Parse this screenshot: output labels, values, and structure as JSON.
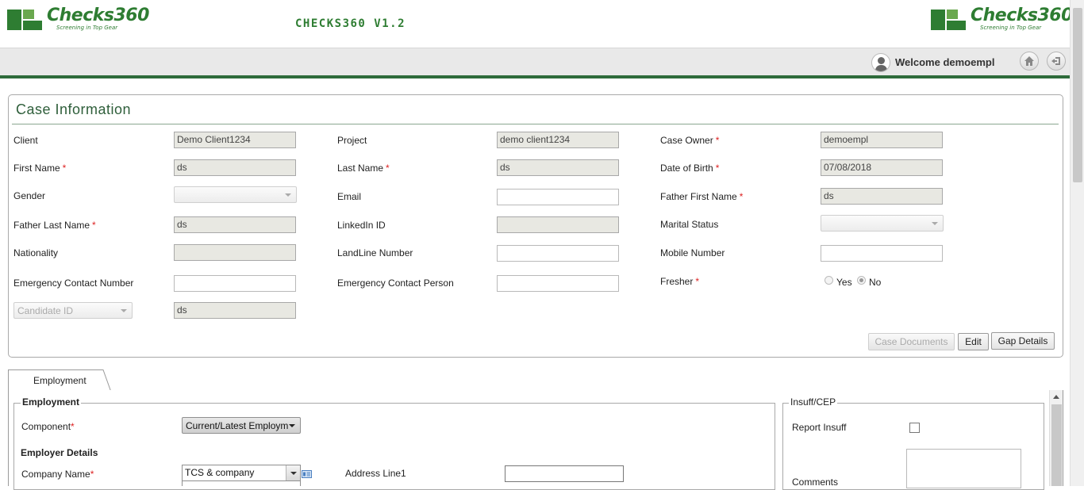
{
  "header": {
    "logo_text": "Checks360",
    "logo_tagline": "Screening in Top Gear",
    "app_title": "CHECKS360 V1.2",
    "welcome": "Welcome demoempl"
  },
  "case": {
    "title": "Case Information",
    "client": {
      "label": "Client",
      "value": "Demo Client1234"
    },
    "project": {
      "label": "Project",
      "value": "demo client1234"
    },
    "case_owner": {
      "label": "Case Owner",
      "value": "demoempl"
    },
    "first_name": {
      "label": "First Name",
      "value": "ds"
    },
    "last_name": {
      "label": "Last Name",
      "value": "ds"
    },
    "dob": {
      "label": "Date of Birth",
      "value": "07/08/2018"
    },
    "gender": {
      "label": "Gender",
      "value": ""
    },
    "email": {
      "label": "Email",
      "value": ""
    },
    "father_first_name": {
      "label": "Father First Name",
      "value": "ds"
    },
    "father_last_name": {
      "label": "Father Last Name",
      "value": "ds"
    },
    "linkedin": {
      "label": "LinkedIn ID",
      "value": ""
    },
    "marital_status": {
      "label": "Marital Status",
      "value": ""
    },
    "nationality": {
      "label": "Nationality",
      "value": ""
    },
    "landline": {
      "label": "LandLine Number",
      "value": ""
    },
    "mobile": {
      "label": "Mobile Number",
      "value": ""
    },
    "emergency_contact_number": {
      "label": "Emergency Contact Number",
      "value": ""
    },
    "emergency_contact_person": {
      "label": "Emergency Contact Person",
      "value": ""
    },
    "fresher": {
      "label": "Fresher",
      "yes": "Yes",
      "no": "No",
      "selected": "No"
    },
    "candidate_id": {
      "placeholder": "Candidate ID",
      "value": "ds"
    },
    "required_mark": "*",
    "buttons": {
      "case_documents": "Case Documents",
      "edit": "Edit",
      "gap_details": "Gap Details"
    }
  },
  "tabs": [
    {
      "label": "Employment",
      "active": true
    }
  ],
  "employment": {
    "legend": "Employment",
    "component_label": "Component",
    "component_value": "Current/Latest Employm",
    "employer_details": "Employer Details",
    "company_name_label": "Company Name",
    "company_name_value": "TCS  & company",
    "address_line1_label": "Address Line1",
    "address_line1_value": ""
  },
  "insuff": {
    "legend": "Insuff/CEP",
    "report_insuff_label": "Report Insuff",
    "report_insuff_checked": false,
    "comments_label": "Comments"
  },
  "colors": {
    "brand_green": "#2e7d32",
    "header_rule": "#2e6b3a",
    "required": "#dd2222"
  }
}
